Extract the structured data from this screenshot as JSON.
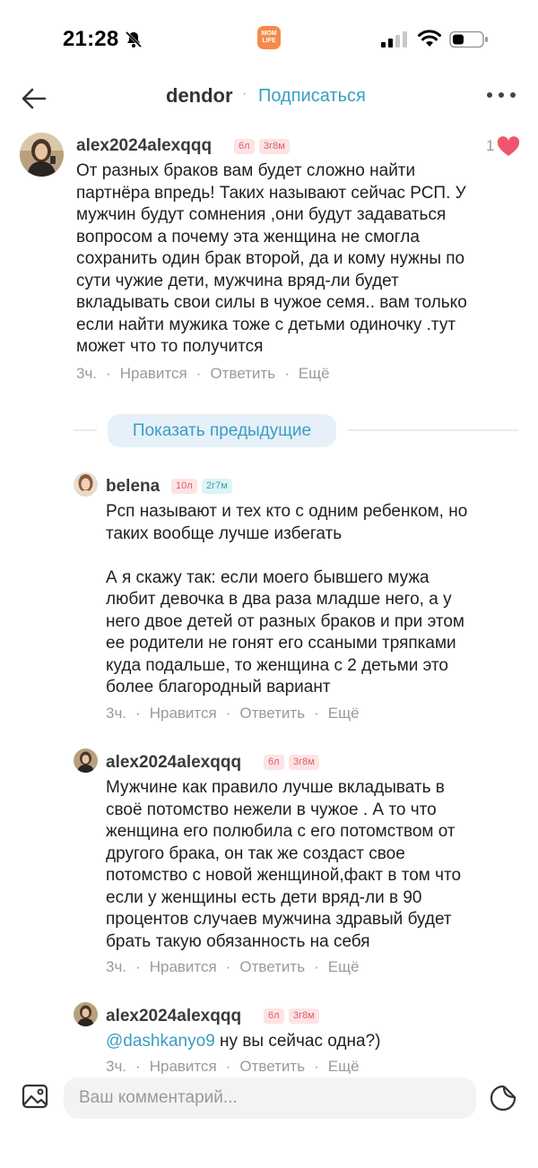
{
  "status_bar": {
    "time": "21:28",
    "app_icon_text": "MOM LIFE"
  },
  "header": {
    "title": "dendor",
    "separator": "·",
    "subscribe": "Подписаться"
  },
  "main_comment": {
    "username": "alex2024alexqqq",
    "age_badge": "6л",
    "duration_badge": "3г8м",
    "likes": "1",
    "text": "От разных браков вам будет сложно найти\nпартнёра впредь! Таких называют сейчас РСП. У\nмужчин будут сомнения ,они будут задаваться\nвопросом а почему эта женщина не смогла\nсохранить один брак второй, да и кому нужны по\nсути чужие дети, мужчина вряд-ли будет\nвкладывать свои силы в чужое семя.. вам только\nесли найти мужика тоже с детьми одиночку .тут\nможет что то получится",
    "time": "3ч.",
    "like_action": "Нравится",
    "reply_action": "Ответить",
    "more_action": "Ещё"
  },
  "show_previous": "Показать предыдущие",
  "replies": [
    {
      "username": "belena",
      "age_badge": "10л",
      "duration_badge": "2г7м",
      "text": "Рсп называют и тех кто с одним ребенком, но\nтаких вообще лучше избегать\n\nА я скажу так: если моего бывшего мужа\nлюбит девочка в два раза младше него, а у\nнего двое детей от разных браков и при этом\nее родители не гонят его ссаными тряпками\nкуда подальше, то женщина с 2 детьми это\nболее благородный вариант",
      "time": "3ч.",
      "like_action": "Нравится",
      "reply_action": "Ответить",
      "more_action": "Ещё"
    },
    {
      "username": "alex2024alexqqq",
      "age_badge": "6л",
      "duration_badge": "3г8м",
      "text": "Мужчине как правило лучше вкладывать в\nсвоё потомство нежели в чужое . А то что\nженщина его полюбила с его потомством от\nдругого брака,  он так же создаст свое\nпотомство с новой женщиной,факт в том что\nесли у женщины есть дети вряд-ли в 90\nпроцентов случаев мужчина здравый будет\nбрать такую обязанность на себя",
      "time": "3ч.",
      "like_action": "Нравится",
      "reply_action": "Ответить",
      "more_action": "Ещё"
    },
    {
      "username": "alex2024alexqqq",
      "age_badge": "6л",
      "duration_badge": "3г8м",
      "mention": "@dashkanyo9",
      "text": " ну вы сейчас одна?)",
      "time": "3ч.",
      "like_action": "Нравится",
      "reply_action": "Ответить",
      "more_action": "Ещё"
    }
  ],
  "composer": {
    "placeholder": "Ваш комментарий..."
  },
  "icons": {
    "back": "arrow-left-icon",
    "more": "more-dots-icon",
    "heart": "heart-icon",
    "gallery": "image-icon",
    "sticker": "sticker-icon"
  },
  "colors": {
    "accent": "#3a9ec2",
    "heart": "#f0566b",
    "badge_pink_bg": "#fde3e4",
    "badge_teal_bg": "#dff3f6"
  }
}
